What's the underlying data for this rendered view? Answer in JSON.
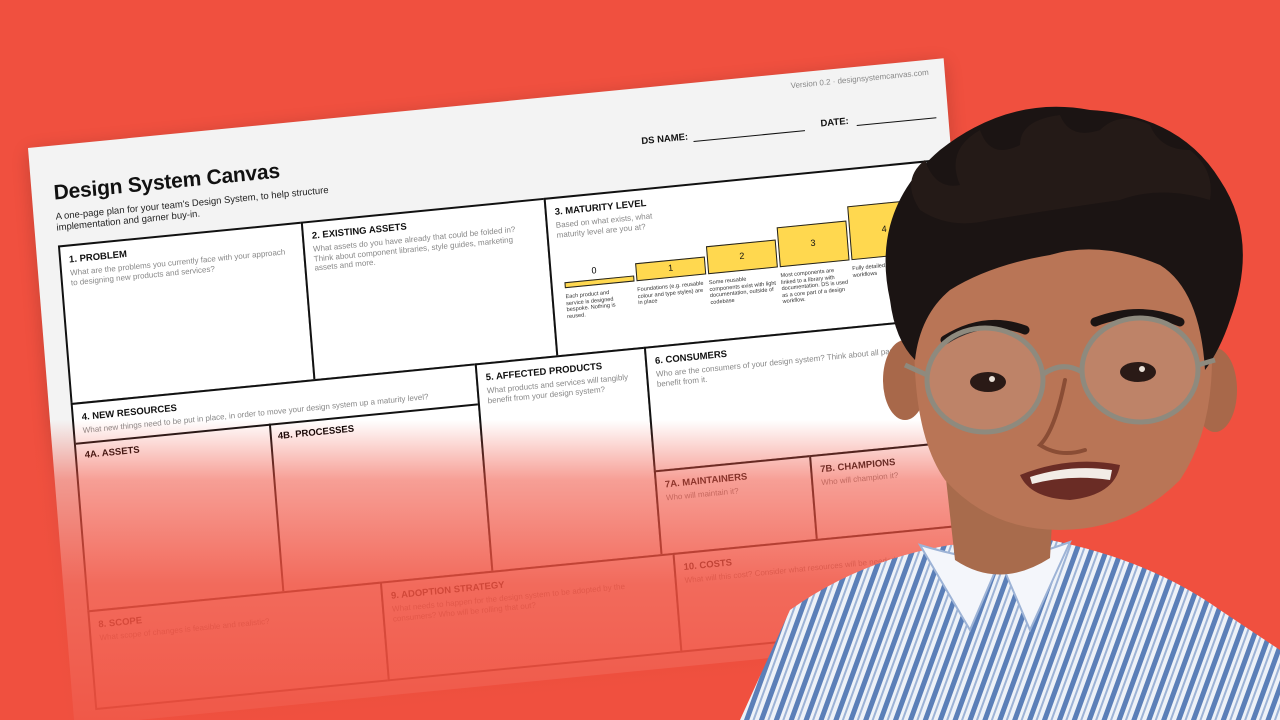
{
  "canvas": {
    "version": "Version 0.2 · designsystemcanvas.com",
    "title": "Design System Canvas",
    "subtitle": "A one-page plan for your team's Design System, to help structure implementation and garner buy-in.",
    "ds_name_label": "DS NAME:",
    "date_label": "DATE:",
    "sections": {
      "problem": {
        "title": "1. PROBLEM",
        "question": "What are the problems you currently face with your approach to designing new products and services?"
      },
      "existing_assets": {
        "title": "2. EXISTING ASSETS",
        "question": "What assets do you have already that could be folded in? Think about component libraries, style guides, marketing assets and more."
      },
      "maturity": {
        "title": "3. MATURITY LEVEL",
        "question": "Based on what exists, what maturity level are you at?",
        "levels": [
          {
            "label": "0",
            "desc": "Each product and service is designed bespoke. Nothing is reused."
          },
          {
            "label": "1",
            "desc": "Foundations (e.g. reusable colour and type styles) are in place"
          },
          {
            "label": "2",
            "desc": "Some reusable components exist with light documentation, outside of codebase"
          },
          {
            "label": "3",
            "desc": "Most components are linked to a library with documentation. DS is used as a core part of a design workflow."
          },
          {
            "label": "4",
            "desc": "Fully detailed, usage all workflows"
          }
        ]
      },
      "new_resources": {
        "title": "4. NEW RESOURCES",
        "question": "What new things need to be put in place, in order to move your design system up a maturity level?"
      },
      "assets": {
        "title": "4A. ASSETS"
      },
      "processes": {
        "title": "4B. PROCESSES"
      },
      "affected_products": {
        "title": "5. AFFECTED PRODUCTS",
        "question": "What products and services will tangibly benefit from your design system?"
      },
      "consumers": {
        "title": "6. CONSUMERS",
        "question": "Who are the consumers of your design system? Think about all parties who will benefit from it."
      },
      "maintainers": {
        "title": "7A. MAINTAINERS",
        "question": "Who will maintain it?"
      },
      "champions": {
        "title": "7B. CHAMPIONS",
        "question": "Who will champion it?"
      },
      "scope": {
        "title": "8. SCOPE",
        "question": "What scope of changes is feasible and realistic?"
      },
      "adoption": {
        "title": "9. ADOPTION STRATEGY",
        "question": "What needs to happen for the design system to be adopted by the consumers? Who will be rolling that out?"
      },
      "costs": {
        "title": "10. COSTS",
        "question": "What will this cost? Consider what resources will be needed, time and money."
      }
    }
  },
  "colors": {
    "background": "#f0503f",
    "step_fill": "#ffd84f",
    "sheet": "#f3f3f3"
  }
}
